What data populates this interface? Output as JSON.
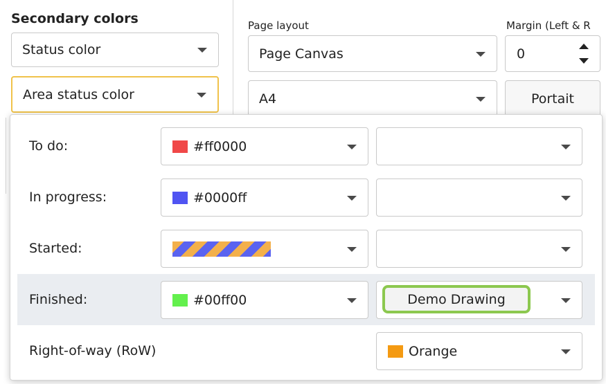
{
  "ribbon": {
    "secondary_colors_title": "Secondary colors",
    "status_color_dropdown": "Status color",
    "area_status_color_dropdown": "Area status color",
    "page_layout_label": "Page layout",
    "page_layout_value": "Page Canvas",
    "paper_size_value": "A4",
    "margin_label": "Margin (Left & R",
    "margin_value": "0",
    "orientation_button": "Portait"
  },
  "status_popup": {
    "rows": [
      {
        "label": "To do:",
        "color_text": "#ff0000",
        "swatch": "#f04848",
        "secondary_value": ""
      },
      {
        "label": "In progress:",
        "color_text": "#0000ff",
        "swatch": "#5054f2",
        "secondary_value": ""
      },
      {
        "label": "Started:",
        "color_text": "",
        "swatch": "striped-pattern",
        "secondary_value": ""
      },
      {
        "label": "Finished:",
        "color_text": "#00ff00",
        "swatch": "#63f04d",
        "secondary_value": "Demo Drawing"
      },
      {
        "label": "Right-of-way (RoW)",
        "secondary_value": "Orange",
        "secondary_swatch": "#f49a12"
      }
    ]
  },
  "colors": {
    "focus_border": "#f0c24a",
    "highlight_ring": "#8cc84f",
    "selected_row_bg": "#eaedf1"
  }
}
